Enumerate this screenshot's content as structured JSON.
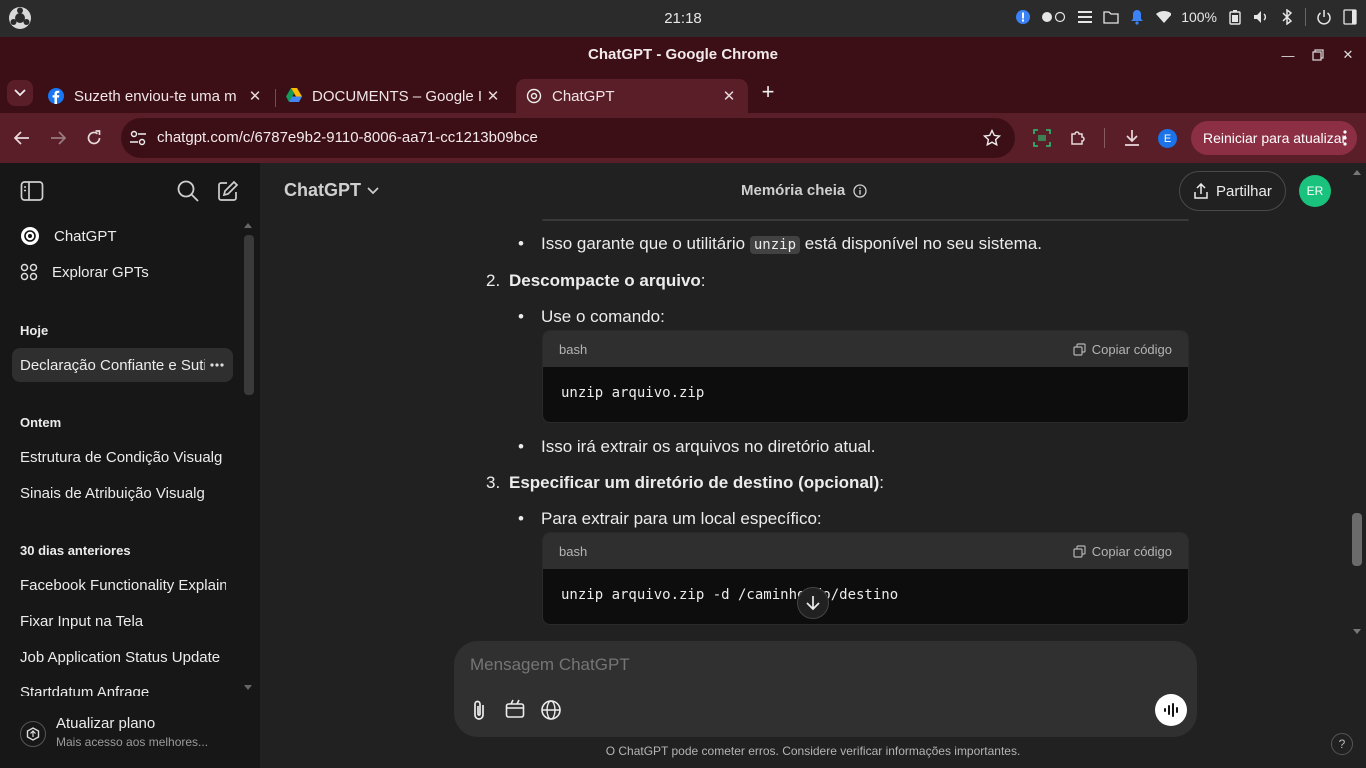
{
  "os": {
    "clock": "21:18",
    "battery": "100%"
  },
  "window": {
    "title": "ChatGPT - Google Chrome"
  },
  "tabs": [
    {
      "label": "Suzeth enviou-te uma m",
      "icon": "facebook-icon"
    },
    {
      "label": "DOCUMENTS – Google I",
      "icon": "google-drive-icon"
    },
    {
      "label": "ChatGPT",
      "icon": "openai-icon"
    }
  ],
  "toolbar": {
    "url": "chatgpt.com/c/6787e9b2-9110-8006-aa71-cc1213b09bce",
    "profile_initial": "E",
    "restart_label": "Reiniciar para atualizar"
  },
  "sidebar": {
    "top_items": [
      {
        "label": "ChatGPT",
        "icon": "openai-icon"
      },
      {
        "label": "Explorar GPTs",
        "icon": "grid-icon"
      }
    ],
    "sections": [
      {
        "heading": "Hoje",
        "items": [
          "Declaração Confiante e Sutil"
        ]
      },
      {
        "heading": "Ontem",
        "items": [
          "Estrutura de Condição Visualg",
          "Sinais de Atribuição Visualg"
        ]
      },
      {
        "heading": "30 dias anteriores",
        "items": [
          "Facebook Functionality Explained",
          "Fixar Input na Tela",
          "Job Application Status Update",
          "Startdatum Anfrage"
        ]
      }
    ],
    "upgrade": {
      "title": "Atualizar plano",
      "subtitle": "Mais acesso aos melhores..."
    }
  },
  "header": {
    "model": "ChatGPT",
    "memory": "Memória cheia",
    "share": "Partilhar",
    "avatar": "ER"
  },
  "chat": {
    "bullet1_pre": "Isso garante que o utilitário",
    "bullet1_code": "unzip",
    "bullet1_post": "está disponível no seu sistema.",
    "step2_num": "2.",
    "step2_title": "Descompacte o arquivo",
    "step2_bullet": "Use o comando:",
    "code1_lang": "bash",
    "code1_copy": "Copiar código",
    "code1_body": "unzip arquivo.zip",
    "step2_bullet2": "Isso irá extrair os arquivos no diretório atual.",
    "step3_num": "3.",
    "step3_title": "Especificar um diretório de destino (opcional)",
    "step3_bullet": "Para extrair para um local específico:",
    "code2_lang": "bash",
    "code2_copy": "Copiar código",
    "code2_body": "unzip arquivo.zip -d /caminho/do/destino"
  },
  "composer": {
    "placeholder": "Mensagem ChatGPT"
  },
  "footer": {
    "disclaimer": "O ChatGPT pode cometer erros. Considere verificar informações importantes.",
    "help": "?"
  },
  "colors": {
    "titlebar": "#3c0f16",
    "toolbar": "#5a1e28",
    "avatar": "#19c37d",
    "sidebar": "#171717",
    "main": "#212121"
  }
}
